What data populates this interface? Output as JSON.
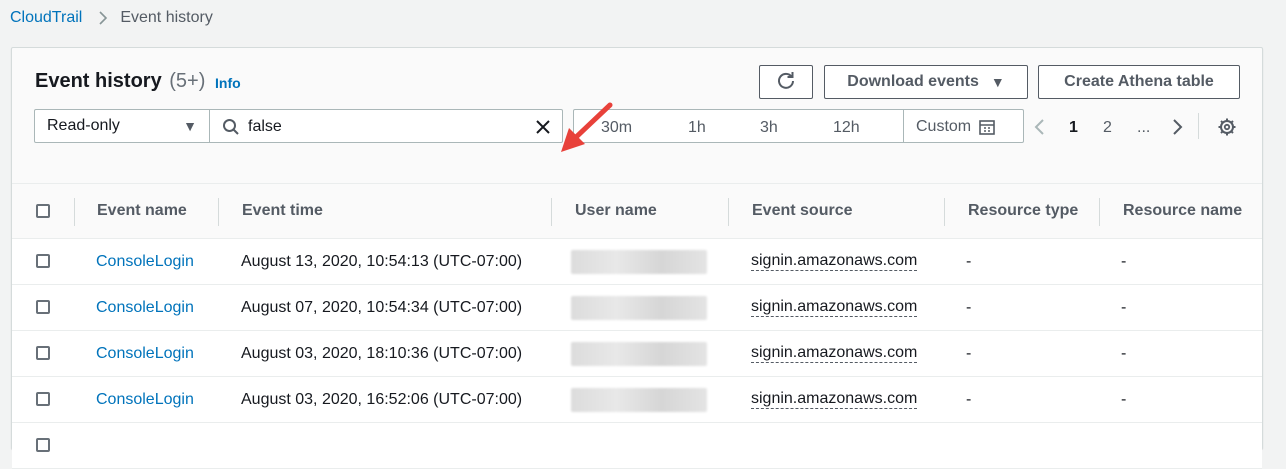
{
  "breadcrumb": {
    "root": "CloudTrail",
    "current": "Event history"
  },
  "panel": {
    "title": "Event history",
    "count": "(5+)",
    "info_link": "Info"
  },
  "toolbar": {
    "download_label": "Download events",
    "athena_label": "Create Athena table"
  },
  "filter": {
    "attribute": "Read-only",
    "search_value": "false"
  },
  "time_range": {
    "options": [
      "30m",
      "1h",
      "3h",
      "12h"
    ],
    "custom_label": "Custom"
  },
  "pagination": {
    "pages": [
      "1",
      "2",
      "..."
    ],
    "current": "1"
  },
  "table": {
    "columns": [
      "Event name",
      "Event time",
      "User name",
      "Event source",
      "Resource type",
      "Resource name"
    ],
    "rows": [
      {
        "event_name": "ConsoleLogin",
        "event_time": "August 13, 2020, 10:54:13 (UTC-07:00)",
        "event_source": "signin.amazonaws.com",
        "resource_type": "-",
        "resource_name": "-"
      },
      {
        "event_name": "ConsoleLogin",
        "event_time": "August 07, 2020, 10:54:34 (UTC-07:00)",
        "event_source": "signin.amazonaws.com",
        "resource_type": "-",
        "resource_name": "-"
      },
      {
        "event_name": "ConsoleLogin",
        "event_time": "August 03, 2020, 18:10:36 (UTC-07:00)",
        "event_source": "signin.amazonaws.com",
        "resource_type": "-",
        "resource_name": "-"
      },
      {
        "event_name": "ConsoleLogin",
        "event_time": "August 03, 2020, 16:52:06 (UTC-07:00)",
        "event_source": "signin.amazonaws.com",
        "resource_type": "-",
        "resource_name": "-"
      }
    ]
  },
  "colors": {
    "link": "#0073bb",
    "annotation_arrow": "#e8413a"
  }
}
